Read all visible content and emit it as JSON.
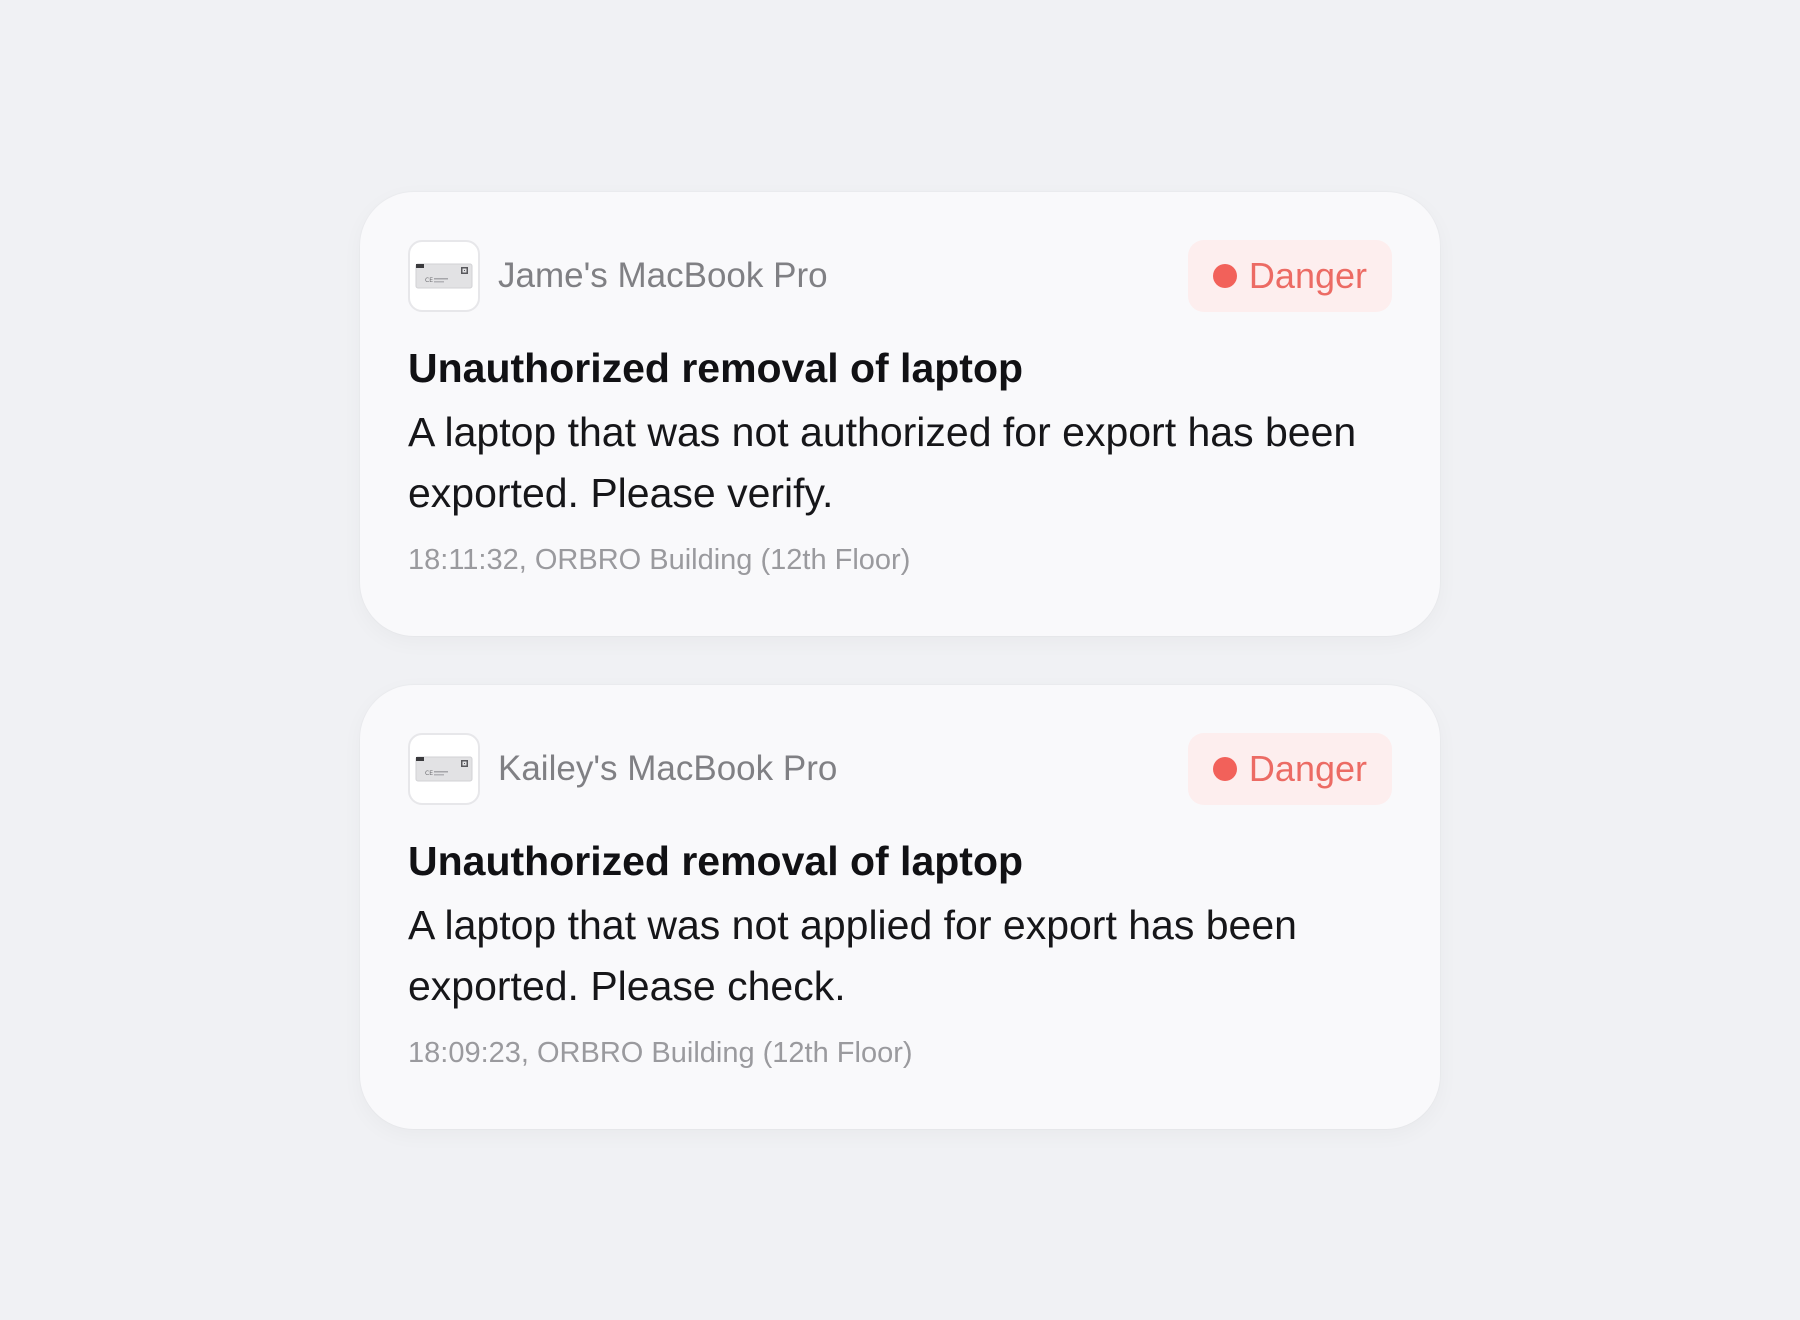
{
  "colors": {
    "background": "#f0f1f4",
    "card": "#f9f9fb",
    "danger": "#ec6b64",
    "danger_dot": "#f2615a",
    "danger_bg": "#fdeeee"
  },
  "alerts": [
    {
      "device_icon": "laptop-thumbnail-icon",
      "device_name": "Jame's MacBook Pro",
      "severity": "Danger",
      "title": "Unauthorized removal of laptop",
      "message": "A laptop that was not authorized for export has been exported. Please verify.",
      "meta": "18:11:32, ORBRO Building (12th Floor)"
    },
    {
      "device_icon": "laptop-thumbnail-icon",
      "device_name": "Kailey's MacBook Pro",
      "severity": "Danger",
      "title": "Unauthorized removal of laptop",
      "message": "A laptop that was not applied for export has been exported. Please check.",
      "meta": "18:09:23, ORBRO Building (12th Floor)"
    }
  ]
}
